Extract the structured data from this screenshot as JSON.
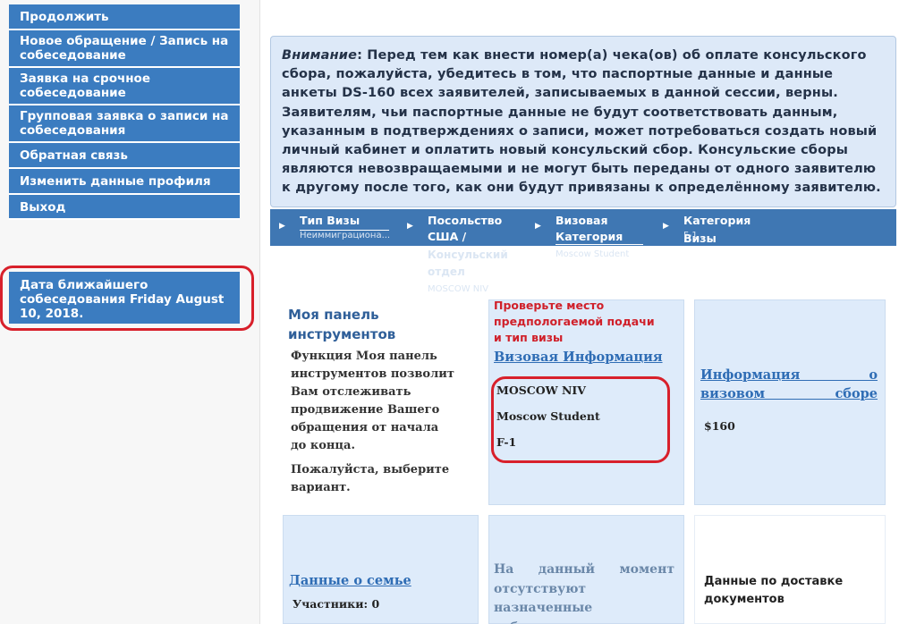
{
  "sidebar": {
    "menu": [
      {
        "label": "Продолжить"
      },
      {
        "label": "Новое обращение / Запись на собеседование"
      },
      {
        "label": "Заявка на срочное собеседование"
      },
      {
        "label": "Групповая заявка о записи на собеседования"
      },
      {
        "label": "Обратная связь"
      },
      {
        "label": "Изменить данные профиля"
      },
      {
        "label": "Выход"
      }
    ],
    "next_interview": "Дата ближайшего собеседования Friday August 10, 2018."
  },
  "alert": {
    "prefix": "Внимание",
    "text": ": Перед тем как внести номер(а) чека(ов) об оплате консульского сбора, пожалуйста, убедитесь в том, что паспортные данные и данные анкеты DS-160 всех заявителей, записываемых в данной сессии, верны. Заявителям, чьи паспортные данные не будут соответствовать данным, указанным в подтверждениях о записи, может потребоваться создать новый личный кабинет и оплатить новый консульский сбор. Консульские сборы являются невозвращаемыми и не могут быть переданы от одного заявителю к другому после того, как они будут привязаны к определённому заявителю."
  },
  "steps": [
    {
      "title": "Тип Визы",
      "value": "Неиммиграциона..."
    },
    {
      "title": "Посольство США / Консульский отдел",
      "title_line1": "Посольство",
      "title_line2": "США /",
      "title_overflow1": "Консульский",
      "title_overflow2": "отдел",
      "value": "MOSCOW NIV"
    },
    {
      "title": "Визовая Категория",
      "title_line1": "Визовая",
      "title_line2": "Категория",
      "value": "Moscow Student"
    },
    {
      "title": "Категория Визы",
      "value": "F-1"
    }
  ],
  "dashboard": {
    "title": "Моя панель инструментов",
    "description": "Функция Моя панель инструментов позволит Вам отслеживать продвижение Вашего обращения от начала до конца.",
    "prompt": "Пожалуйста, выберите вариант."
  },
  "visa_info": {
    "note": "Проверьте место предпологаемой подачи и тип визы",
    "link": "Визовая Информация",
    "post": "MOSCOW NIV",
    "category": "Moscow Student",
    "class": "F-1"
  },
  "fee_info": {
    "link": "Информация о визовом сборе",
    "amount": "$160"
  },
  "family": {
    "link": "Данные о семье",
    "members_label": "Участники:",
    "members_count": "0"
  },
  "appointments": {
    "text": "На данный момент отсутствуют назначенные собеседования"
  },
  "delivery": {
    "text": "Данные по доставке документов"
  },
  "colors": {
    "menu_blue": "#3b7cc0",
    "alert_bg": "#dde9f8",
    "step_bar": "#3f77b3",
    "tile_bg": "#deebfa",
    "highlight_red": "#d8202b",
    "link_blue": "#2f6db5"
  }
}
